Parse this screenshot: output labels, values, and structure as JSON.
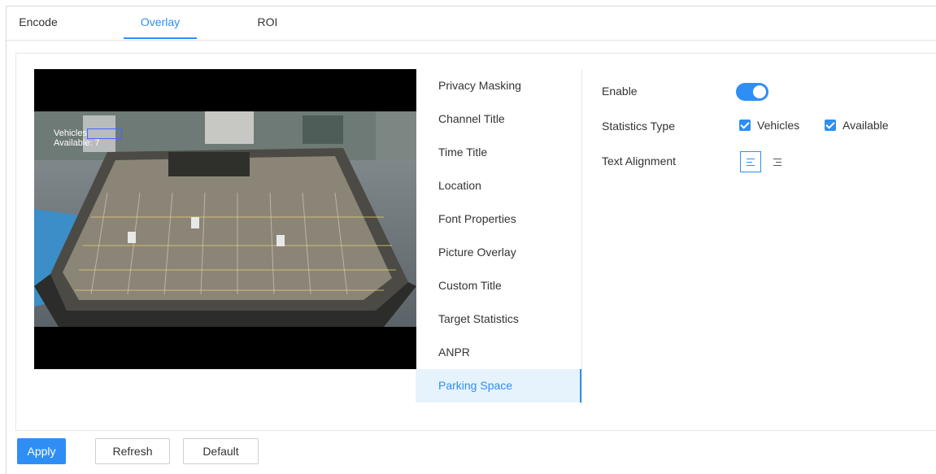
{
  "tabs": [
    {
      "label": "Encode"
    },
    {
      "label": "Overlay"
    },
    {
      "label": "ROI"
    }
  ],
  "video": {
    "osd_line1_label": "Vehicles",
    "osd_line1_value": "",
    "osd_line2": "Available: 7"
  },
  "menu": {
    "items": [
      {
        "label": "Privacy Masking"
      },
      {
        "label": "Channel Title"
      },
      {
        "label": "Time Title"
      },
      {
        "label": "Location"
      },
      {
        "label": "Font Properties"
      },
      {
        "label": "Picture Overlay"
      },
      {
        "label": "Custom Title"
      },
      {
        "label": "Target Statistics"
      },
      {
        "label": "ANPR"
      },
      {
        "label": "Parking Space"
      }
    ],
    "active_item": "Parking Space"
  },
  "settings": {
    "enable_label": "Enable",
    "enable_on": true,
    "statistics_type_label": "Statistics Type",
    "vehicles_label": "Vehicles",
    "vehicles_checked": true,
    "available_label": "Available",
    "available_checked": true,
    "text_alignment_label": "Text Alignment",
    "alignment_selected": "left"
  },
  "footer": {
    "apply_label": "Apply",
    "refresh_label": "Refresh",
    "default_label": "Default"
  },
  "colors": {
    "accent": "#2f8ef5",
    "active_bg": "#e6f3fd"
  }
}
